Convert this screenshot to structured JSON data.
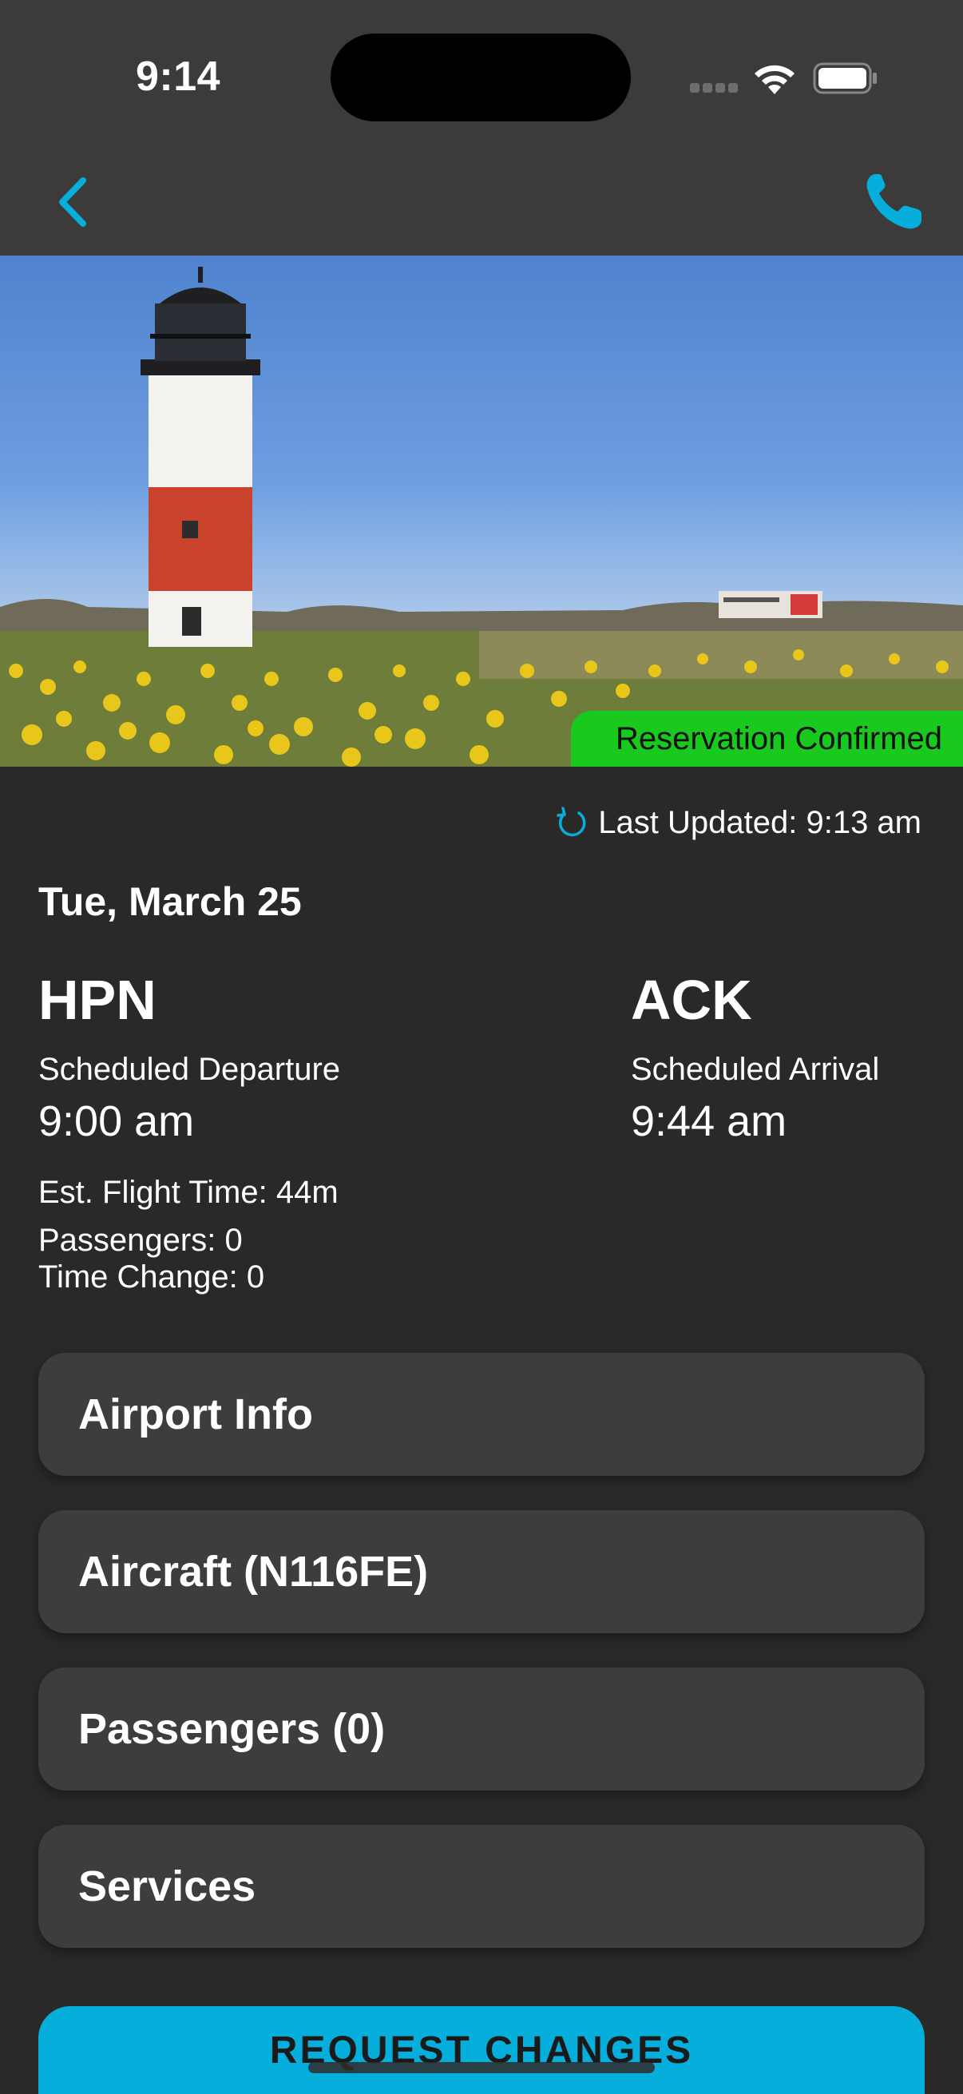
{
  "status_bar": {
    "time": "9:14"
  },
  "header": {
    "back_icon": "chevron-left-icon",
    "call_icon": "phone-icon",
    "accent": "#05aedb"
  },
  "hero": {
    "badge": "Reservation Confirmed",
    "badge_color": "#19c91d"
  },
  "updated": {
    "icon": "refresh-icon",
    "text": "Last Updated: 9:13 am"
  },
  "trip": {
    "date": "Tue, March 25",
    "departure": {
      "code": "HPN",
      "label": "Scheduled Departure",
      "time": "9:00 am"
    },
    "arrival": {
      "code": "ACK",
      "label": "Scheduled Arrival",
      "time": "9:44 am"
    },
    "est_flight_time": "Est. Flight Time: 44m",
    "passengers": "Passengers: 0",
    "time_change": "Time Change: 0"
  },
  "sections": [
    {
      "label": "Airport Info"
    },
    {
      "label": "Aircraft (N116FE)"
    },
    {
      "label": "Passengers (0)"
    },
    {
      "label": "Services"
    }
  ],
  "request_button": {
    "label": "REQUEST CHANGES"
  }
}
